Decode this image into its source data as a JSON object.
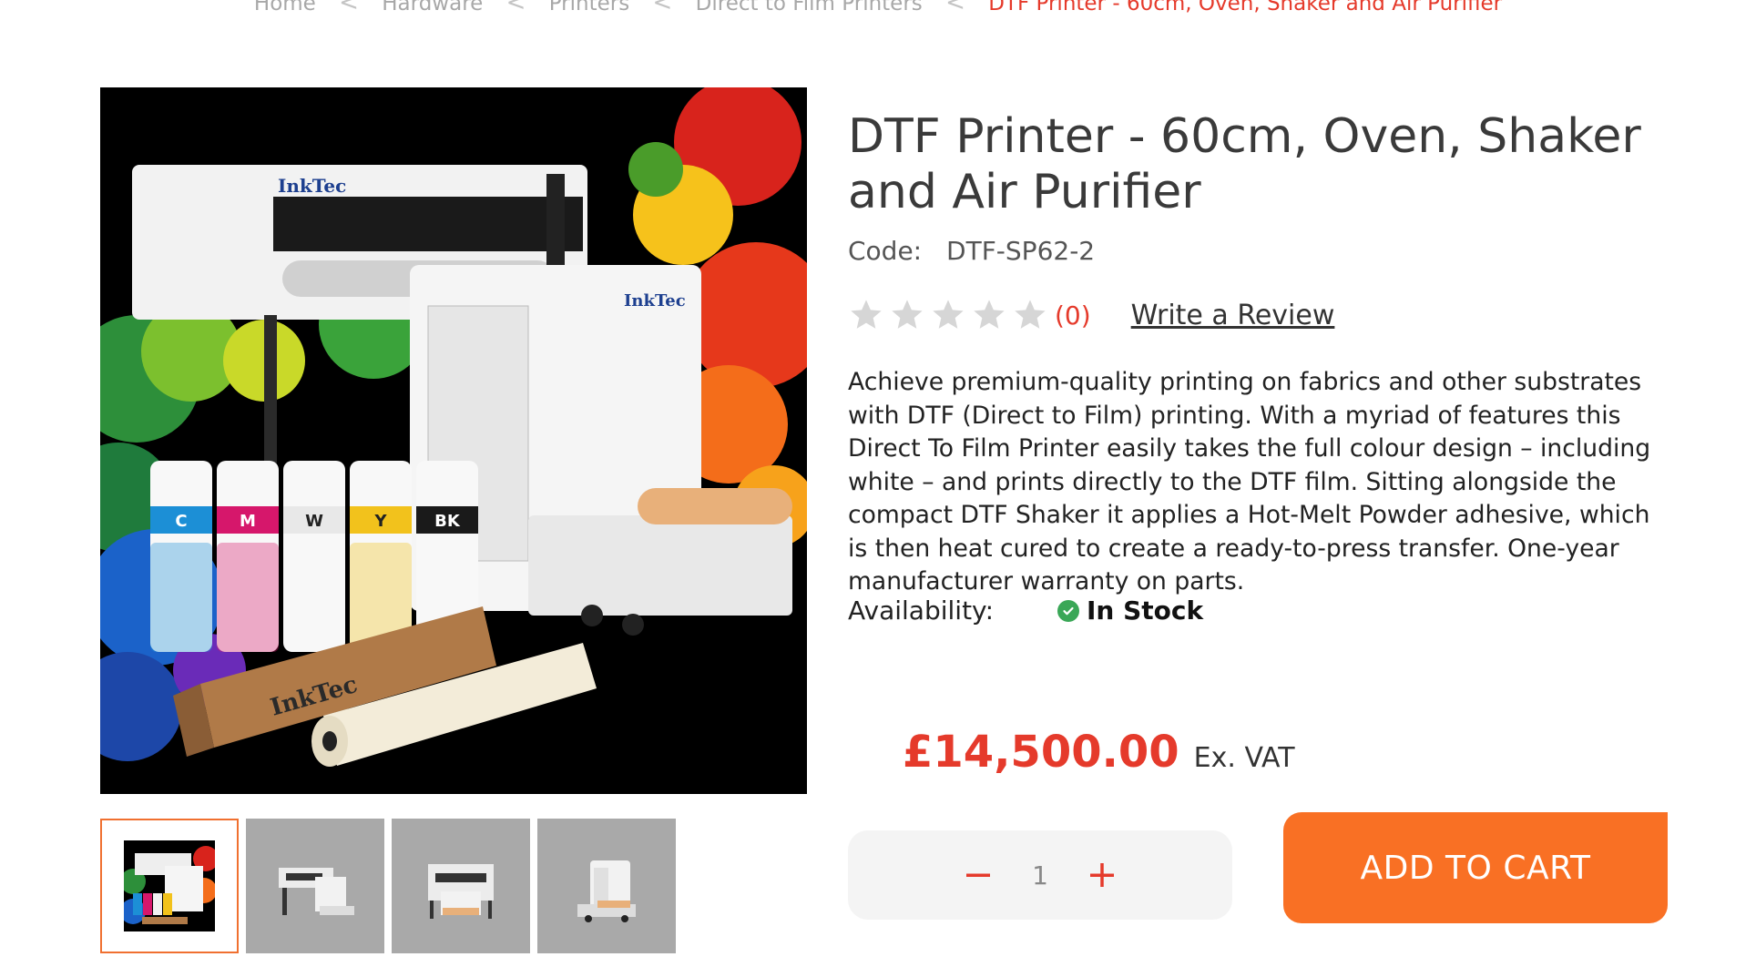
{
  "breadcrumb": {
    "items": [
      "Home",
      "Hardware",
      "Printers",
      "Direct to Film Printers"
    ],
    "current": "DTF Printer - 60cm, Oven, Shaker and Air Purifier",
    "separator": "<"
  },
  "product": {
    "title": "DTF Printer - 60cm, Oven, Shaker and Air Purifier",
    "code_label": "Code:",
    "code_value": "DTF-SP62-2",
    "rating_count": "(0)",
    "write_review": "Write a Review",
    "description": "Achieve premium-quality printing on fabrics and other substrates with DTF (Direct to Film) printing. With a myriad of features this Direct To Film Printer easily takes the full colour design – including white – and prints directly to the DTF film. Sitting alongside the compact DTF Shaker it applies a Hot-Melt Powder adhesive, which is then heat cured to create a ready-to-press transfer. One-year manufacturer warranty on parts.",
    "availability_label": "Availability:",
    "availability_value": "In Stock",
    "price": "£14,500.00",
    "price_suffix": "Ex. VAT",
    "quantity": "1",
    "add_to_cart": "ADD TO CART",
    "stars_filled": 0,
    "stars_total": 5
  },
  "image": {
    "brand": "InkTec",
    "roll_brand": "InkTec",
    "bottles": [
      "C",
      "M",
      "W",
      "Y",
      "BK"
    ]
  },
  "colors": {
    "accent": "#e53a2b",
    "cta": "#f97024",
    "in_stock": "#3aa757",
    "star_empty": "#d6d6d6"
  },
  "icons": {
    "minus": "minus-icon",
    "plus": "plus-icon",
    "check": "check-circle-icon",
    "star": "star-icon"
  }
}
